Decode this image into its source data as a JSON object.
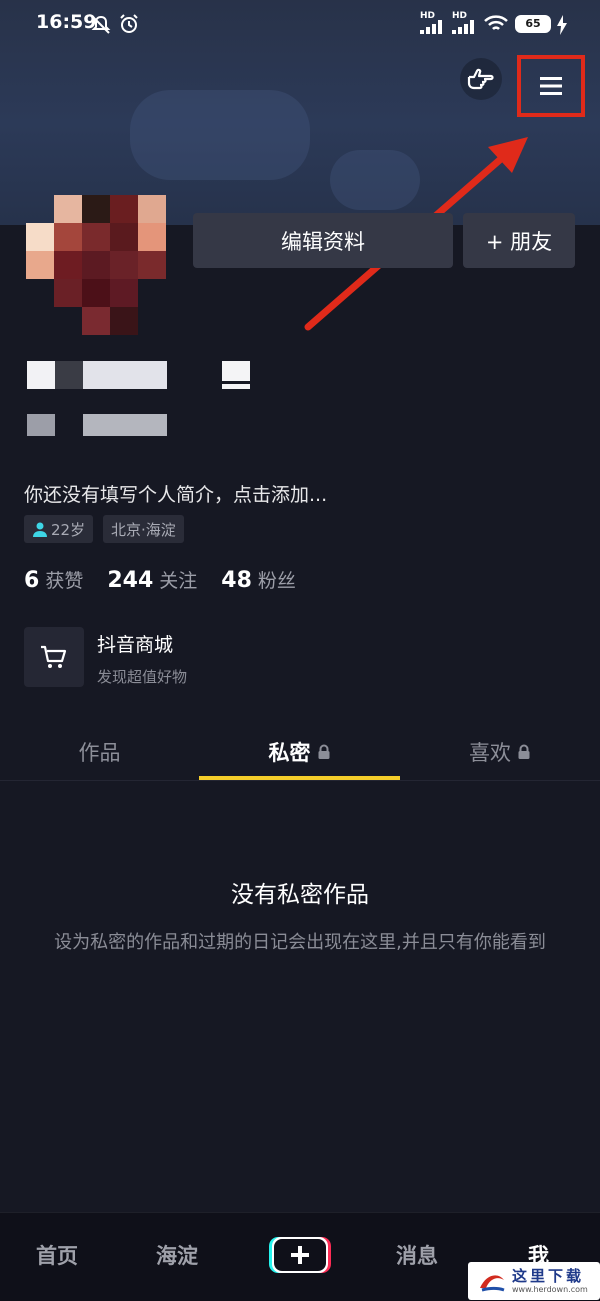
{
  "status_bar": {
    "time": "16:59",
    "net1": "HD",
    "net2": "HD",
    "battery": "65"
  },
  "header": {
    "edit_profile": "编辑资料",
    "add_friend": "+ 朋友"
  },
  "profile": {
    "bio": "你还没有填写个人简介，点击添加...",
    "age_tag": "22岁",
    "location_tag": "北京·海淀"
  },
  "stats": [
    {
      "value": "6",
      "label": "获赞"
    },
    {
      "value": "244",
      "label": "关注"
    },
    {
      "value": "48",
      "label": "粉丝"
    }
  ],
  "mall": {
    "title": "抖音商城",
    "subtitle": "发现超值好物"
  },
  "tabs": [
    {
      "label": "作品",
      "locked": false
    },
    {
      "label": "私密",
      "locked": true
    },
    {
      "label": "喜欢",
      "locked": true
    }
  ],
  "empty_state": {
    "title": "没有私密作品",
    "description": "设为私密的作品和过期的日记会出现在这里,并且只有你能看到"
  },
  "bottom_nav": {
    "home": "首页",
    "location": "海淀",
    "messages": "消息",
    "me": "我"
  },
  "watermark": {
    "text": "这里下载",
    "url": "www.herdown.com"
  },
  "colors": {
    "background": "#161823",
    "accent_underline": "#f5cd2a",
    "annotation_red": "#e02a1a",
    "age_icon": "#3ed6e6"
  },
  "icons": {
    "menu": "hamburger-menu-icon",
    "hand": "pointing-hand-icon",
    "cart": "shopping-cart-icon",
    "lock": "lock-icon",
    "plus": "plus-icon"
  }
}
